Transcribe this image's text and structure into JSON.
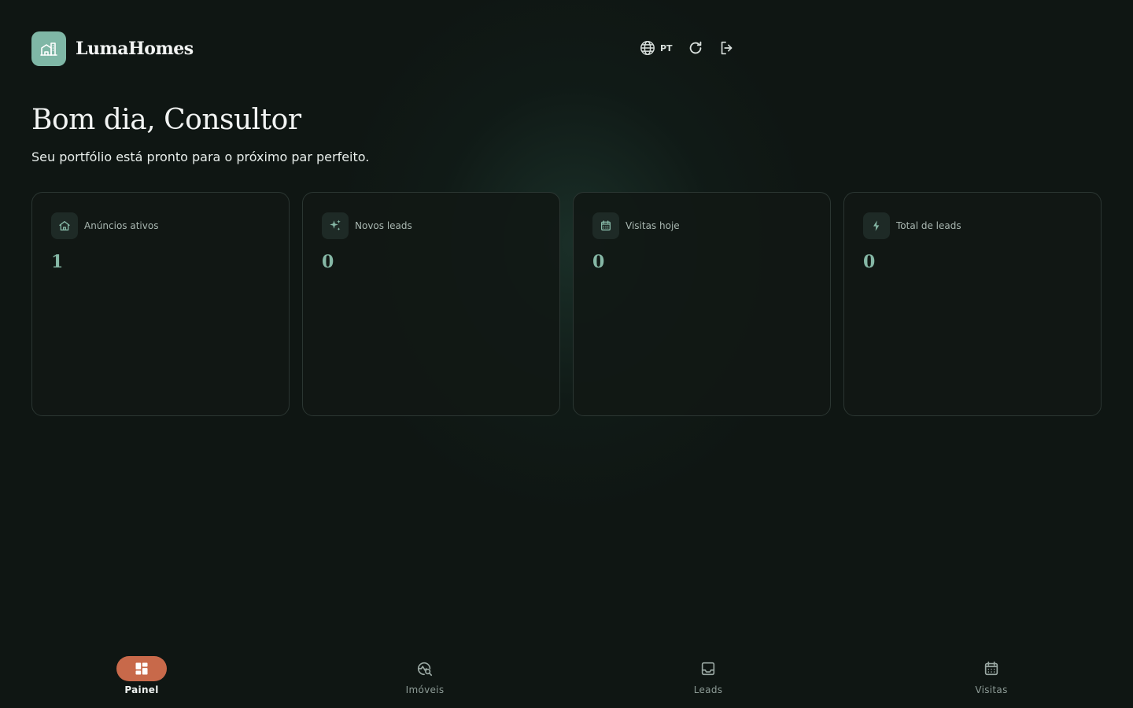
{
  "header": {
    "brand": "LumaHomes",
    "language": "PT"
  },
  "greeting": "Bom dia, Consultor",
  "subtitle": "Seu portfólio está pronto para o próximo par perfeito.",
  "stats": [
    {
      "label": "Anúncios ativos",
      "value": "1",
      "icon": "home-icon"
    },
    {
      "label": "Novos leads",
      "value": "0",
      "icon": "sparkles-icon"
    },
    {
      "label": "Visitas hoje",
      "value": "0",
      "icon": "calendar-icon"
    },
    {
      "label": "Total de leads",
      "value": "0",
      "icon": "bolt-icon"
    }
  ],
  "nav": [
    {
      "label": "Painel",
      "icon": "dashboard-icon",
      "active": true
    },
    {
      "label": "Imóveis",
      "icon": "property-search-icon",
      "active": false
    },
    {
      "label": "Leads",
      "icon": "inbox-icon",
      "active": false
    },
    {
      "label": "Visitas",
      "icon": "calendar-icon",
      "active": false
    }
  ],
  "colors": {
    "background": "#0f1613",
    "accent": "#86b8a6",
    "logo": "#7fb7a6",
    "active_nav": "#c8694a"
  }
}
